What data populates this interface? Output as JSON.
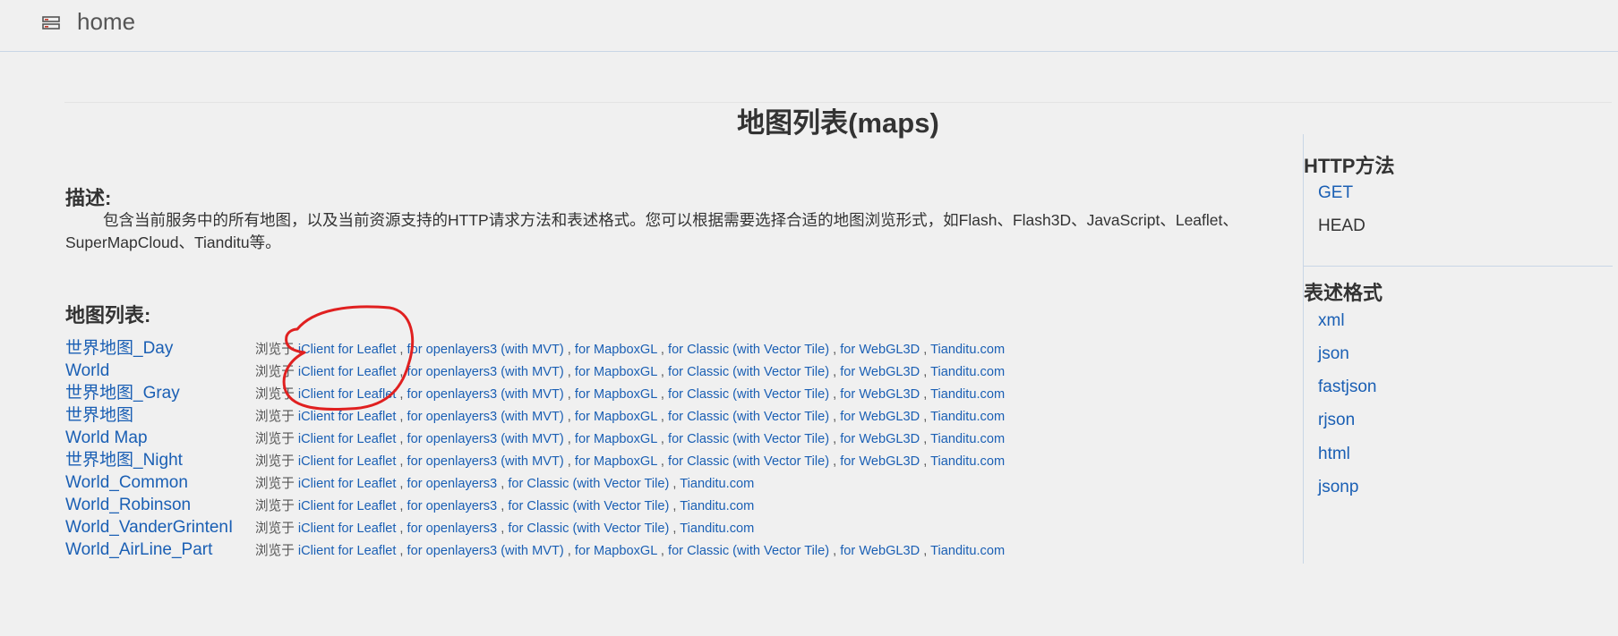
{
  "topbar": {
    "title": "home"
  },
  "page": {
    "title": "地图列表(maps)"
  },
  "description": {
    "heading": "描述:",
    "text": "包含当前服务中的所有地图，以及当前资源支持的HTTP请求方法和表述格式。您可以根据需要选择合适的地图浏览形式，如Flash、Flash3D、JavaScript、Leaflet、SuperMapCloud、Tianditu等。"
  },
  "map_list": {
    "heading": "地图列表:",
    "prefix": "浏览于",
    "items": [
      {
        "name": "世界地图_Day",
        "links": [
          "iClient for Leaflet",
          "for openlayers3 (with MVT)",
          "for MapboxGL",
          "for Classic (with Vector Tile)",
          "for WebGL3D",
          "Tianditu.com"
        ]
      },
      {
        "name": "World",
        "links": [
          "iClient for Leaflet",
          "for openlayers3 (with MVT)",
          "for MapboxGL",
          "for Classic (with Vector Tile)",
          "for WebGL3D",
          "Tianditu.com"
        ]
      },
      {
        "name": "世界地图_Gray",
        "links": [
          "iClient for Leaflet",
          "for openlayers3 (with MVT)",
          "for MapboxGL",
          "for Classic (with Vector Tile)",
          "for WebGL3D",
          "Tianditu.com"
        ]
      },
      {
        "name": "世界地图",
        "links": [
          "iClient for Leaflet",
          "for openlayers3 (with MVT)",
          "for MapboxGL",
          "for Classic (with Vector Tile)",
          "for WebGL3D",
          "Tianditu.com"
        ]
      },
      {
        "name": "World Map",
        "links": [
          "iClient for Leaflet",
          "for openlayers3 (with MVT)",
          "for MapboxGL",
          "for Classic (with Vector Tile)",
          "for WebGL3D",
          "Tianditu.com"
        ]
      },
      {
        "name": "世界地图_Night",
        "links": [
          "iClient for Leaflet",
          "for openlayers3 (with MVT)",
          "for MapboxGL",
          "for Classic (with Vector Tile)",
          "for WebGL3D",
          "Tianditu.com"
        ]
      },
      {
        "name": "World_Common",
        "links": [
          "iClient for Leaflet",
          "for openlayers3",
          "for Classic (with Vector Tile)",
          "Tianditu.com"
        ]
      },
      {
        "name": "World_Robinson",
        "links": [
          "iClient for Leaflet",
          "for openlayers3",
          "for Classic (with Vector Tile)",
          "Tianditu.com"
        ]
      },
      {
        "name": "World_VanderGrintenI",
        "links": [
          "iClient for Leaflet",
          "for openlayers3",
          "for Classic (with Vector Tile)",
          "Tianditu.com"
        ]
      },
      {
        "name": "World_AirLine_Part",
        "links": [
          "iClient for Leaflet",
          "for openlayers3 (with MVT)",
          "for MapboxGL",
          "for Classic (with Vector Tile)",
          "for WebGL3D",
          "Tianditu.com"
        ]
      }
    ]
  },
  "sidebar": {
    "http_heading": "HTTP方法",
    "http_methods": [
      {
        "label": "GET",
        "link": true
      },
      {
        "label": "HEAD",
        "link": false
      }
    ],
    "format_heading": "表述格式",
    "formats": [
      "xml",
      "json",
      "fastjson",
      "rjson",
      "html",
      "jsonp"
    ]
  },
  "colors": {
    "background": "#f0f0f0",
    "link": "#1a5fb4",
    "annotation": "#e02020"
  },
  "icons": {
    "menu": "server-menu-icon"
  }
}
